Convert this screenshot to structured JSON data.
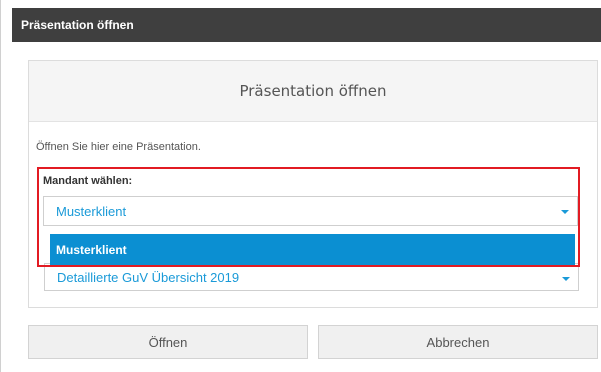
{
  "window": {
    "title": "Präsentation öffnen"
  },
  "panel": {
    "header": "Präsentation öffnen",
    "intro": "Öffnen Sie hier eine Präsentation.",
    "mandant_label": "Mandant wählen:",
    "mandant_selected": "Musterklient",
    "dropdown_options": [
      "Musterklient"
    ],
    "presentation_selected": "Detaillierte GuV Übersicht 2019"
  },
  "buttons": {
    "open": "Öffnen",
    "cancel": "Abbrechen"
  },
  "colors": {
    "accent": "#1a9ad8",
    "highlight_option": "#0b8fd2",
    "titlebar": "#3f3f3f",
    "annotation": "#e21b23"
  }
}
